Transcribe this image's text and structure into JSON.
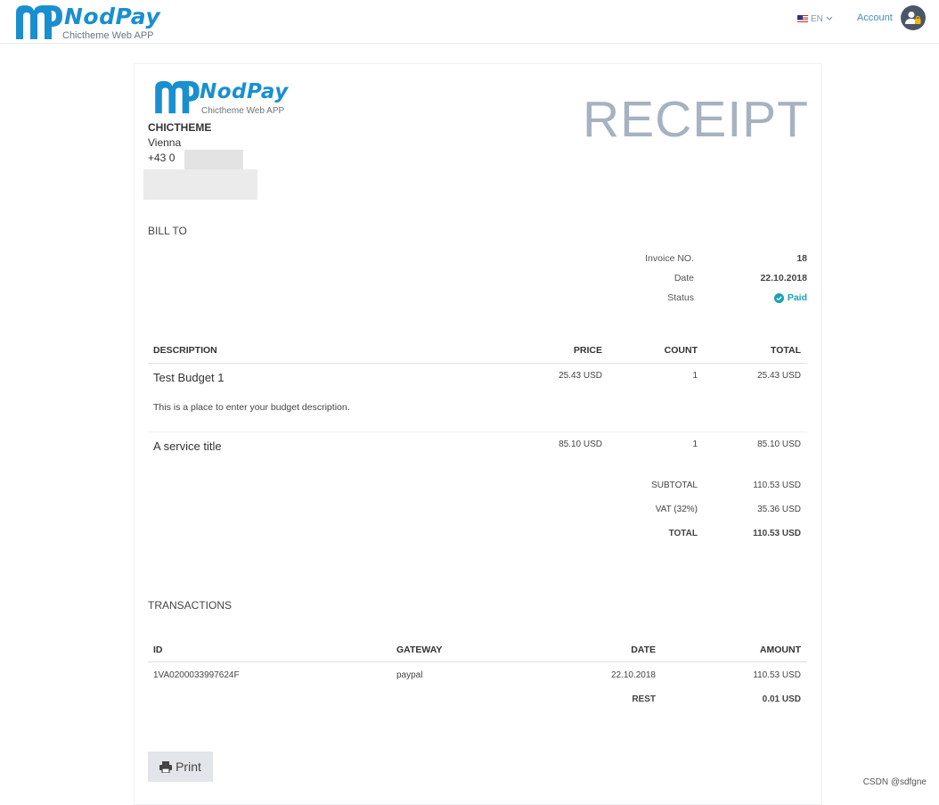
{
  "header": {
    "brand": "NodPay",
    "tagline": "Chictheme Web APP",
    "language": "EN",
    "account_label": "Account"
  },
  "receipt": {
    "brand": "NodPay",
    "tagline": "Chictheme Web APP",
    "title": "RECEIPT",
    "company": {
      "name": "CHICTHEME",
      "city": "Vienna",
      "phone": "+43 0"
    },
    "bill_to_label": "BILL TO",
    "meta": {
      "invoice_label": "Invoice NO.",
      "invoice_value": "18",
      "date_label": "Date",
      "date_value": "22.10.2018",
      "status_label": "Status",
      "status_value": "Paid"
    },
    "items_table": {
      "headers": {
        "description": "DESCRIPTION",
        "price": "PRICE",
        "count": "COUNT",
        "total": "TOTAL"
      },
      "rows": [
        {
          "title": "Test Budget 1",
          "description": "This is a place to enter your budget description.",
          "price": "25.43 USD",
          "count": "1",
          "total": "25.43 USD"
        },
        {
          "title": "A service title",
          "description": "",
          "price": "85.10 USD",
          "count": "1",
          "total": "85.10 USD"
        }
      ],
      "subtotal_label": "SUBTOTAL",
      "subtotal_value": "110.53 USD",
      "vat_label": "VAT (32%)",
      "vat_value": "35.36 USD",
      "total_label": "TOTAL",
      "total_value": "110.53 USD"
    },
    "transactions": {
      "title": "TRANSACTIONS",
      "headers": {
        "id": "ID",
        "gateway": "GATEWAY",
        "date": "DATE",
        "amount": "AMOUNT"
      },
      "rows": [
        {
          "id": "1VA0200033997624F",
          "gateway": "paypal",
          "date": "22.10.2018",
          "amount": "110.53 USD"
        }
      ],
      "rest_label": "REST",
      "rest_value": "0.01 USD"
    },
    "print_label": "Print"
  },
  "watermark": "CSDN @sdfgne",
  "colors": {
    "brand": "#1a8fd0",
    "paid": "#17a2b8",
    "receipt_title": "#a6b2c2",
    "avatar_bg": "#4b5668"
  },
  "icons": {
    "flag": "us-flag-icon",
    "avatar": "user-lock-icon",
    "status": "check-circle-icon",
    "print": "printer-icon"
  }
}
